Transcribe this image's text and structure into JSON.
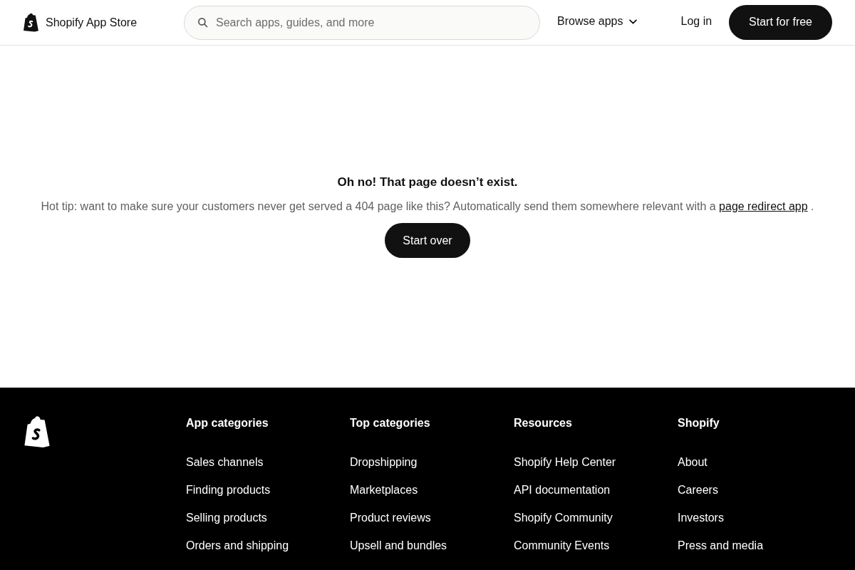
{
  "header": {
    "brand": "Shopify App Store",
    "search": {
      "placeholder": "Search apps, guides, and more"
    },
    "nav": [
      {
        "label": "Browse apps",
        "kind": "dropdown"
      },
      {
        "label": "Log in",
        "kind": "link"
      },
      {
        "label": "Start for free",
        "kind": "button"
      }
    ]
  },
  "main": {
    "title": "Oh no! That page doesn’t exist.",
    "tip": {
      "text": "Hot tip: want to make sure your customers never get served a 404 page like this? Automatically send them somewhere relevant with a",
      "link": "page redirect app",
      "after": "."
    },
    "button": "Start over"
  },
  "footer": {
    "columns": [
      {
        "heading": "App categories",
        "links": [
          "Sales channels",
          "Finding products",
          "Selling products",
          "Orders and shipping"
        ]
      },
      {
        "heading": "Top categories",
        "links": [
          "Dropshipping",
          "Marketplaces",
          "Product reviews",
          "Upsell and bundles"
        ]
      },
      {
        "heading": "Resources",
        "links": [
          "Shopify Help Center",
          "API documentation",
          "Shopify Community",
          "Community Events"
        ]
      },
      {
        "heading": "Shopify",
        "links": [
          "About",
          "Careers",
          "Investors",
          "Press and media"
        ]
      }
    ]
  }
}
